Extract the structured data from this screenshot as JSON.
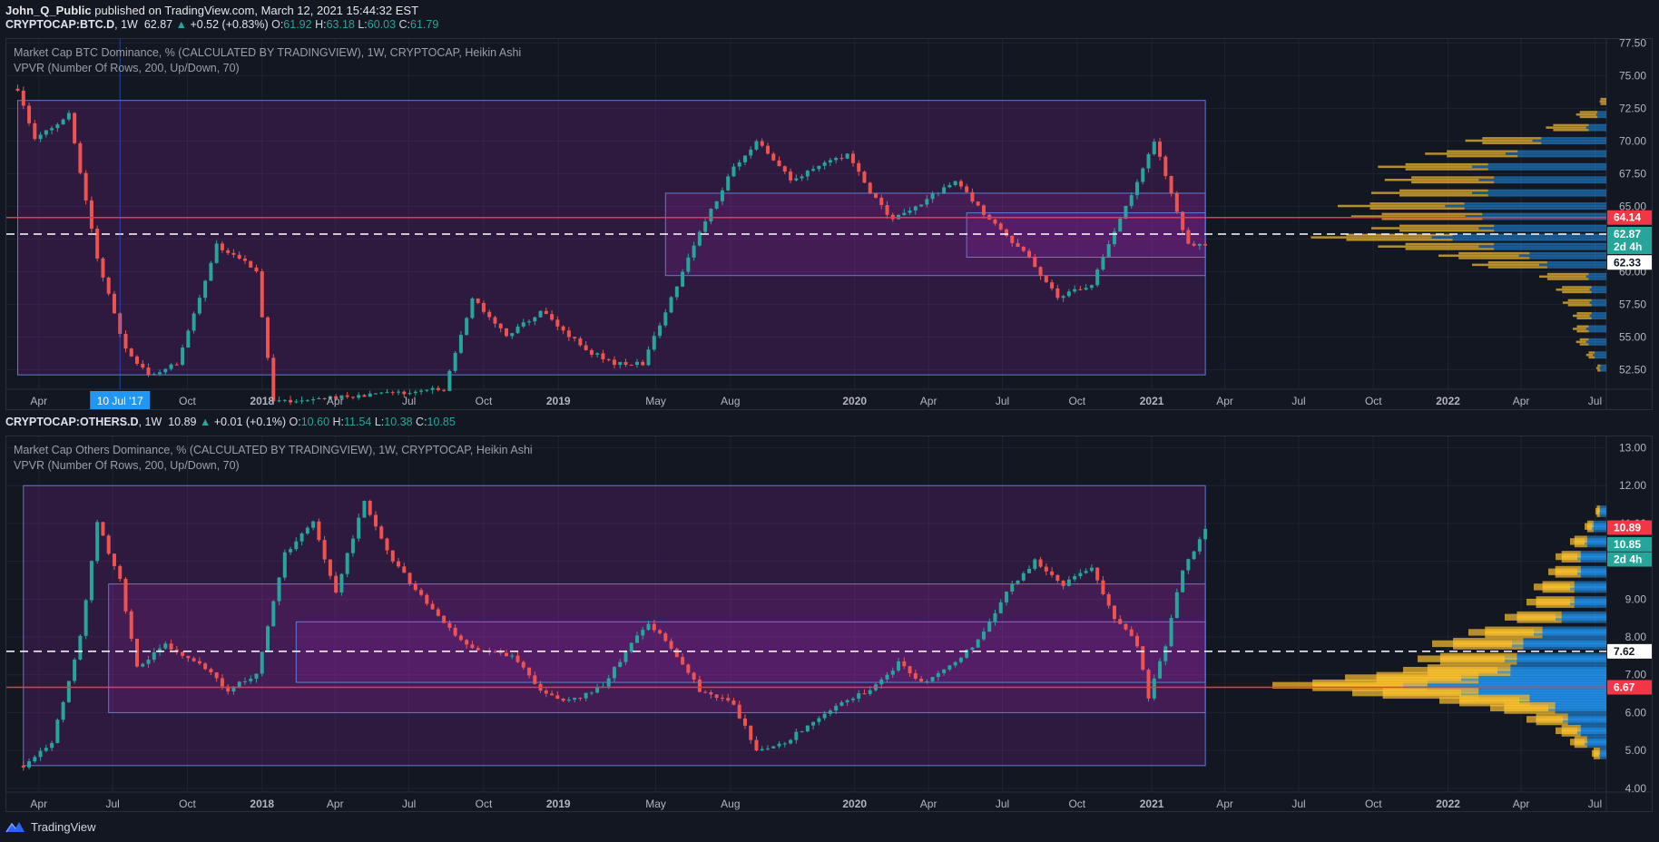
{
  "publish_line": {
    "author": "John_Q_Public",
    "text": " published on TradingView.com, March 12, 2021 15:44:32 EST"
  },
  "brand": {
    "name": "TradingView",
    "logo": "tradingview-logo-icon",
    "colors": {
      "background": "#131722",
      "up": "#26a69a",
      "down": "#ef5350",
      "box": "#5d7bd8",
      "accent": "#2962ff"
    }
  },
  "chart_data": [
    {
      "type": "candlestick",
      "symbol": "CRYPTOCAP:BTC.D",
      "interval": "1W",
      "last": "62.87",
      "change": "+0.52 (+0.83%)",
      "ohlc": {
        "o": "61.92",
        "h": "63.18",
        "l": "60.03",
        "c": "61.79"
      },
      "legend": {
        "main": "Market Cap BTC Dominance, % (CALCULATED BY TRADINGVIEW), 1W, CRYPTOCAP, Heikin Ashi",
        "indicator": "VPVR (Number Of Rows, 200, Up/Down, 70)"
      },
      "ylim": [
        51.0,
        77.8
      ],
      "y_ticks": [
        "52.50",
        "55.00",
        "57.50",
        "60.00",
        "62.50",
        "65.00",
        "67.50",
        "70.00",
        "72.50",
        "75.00",
        "77.50"
      ],
      "x_ticks": [
        {
          "label": "Apr",
          "date": "2017-04-01",
          "bold": false
        },
        {
          "label": "Oct",
          "date": "2017-10-01",
          "bold": false
        },
        {
          "label": "2018",
          "date": "2018-01-01",
          "bold": true
        },
        {
          "label": "Apr",
          "date": "2018-04-01",
          "bold": false
        },
        {
          "label": "Jul",
          "date": "2018-07-01",
          "bold": false
        },
        {
          "label": "Oct",
          "date": "2018-10-01",
          "bold": false
        },
        {
          "label": "2019",
          "date": "2019-01-01",
          "bold": true
        },
        {
          "label": "May",
          "date": "2019-05-01",
          "bold": false
        },
        {
          "label": "Aug",
          "date": "2019-08-01",
          "bold": false
        },
        {
          "label": "2020",
          "date": "2020-01-01",
          "bold": true
        },
        {
          "label": "Apr",
          "date": "2020-04-01",
          "bold": false
        },
        {
          "label": "Jul",
          "date": "2020-07-01",
          "bold": false
        },
        {
          "label": "Oct",
          "date": "2020-10-01",
          "bold": false
        },
        {
          "label": "2021",
          "date": "2021-01-01",
          "bold": true
        },
        {
          "label": "Apr",
          "date": "2021-04-01",
          "bold": false
        },
        {
          "label": "Jul",
          "date": "2021-07-01",
          "bold": false
        },
        {
          "label": "Oct",
          "date": "2021-10-01",
          "bold": false
        },
        {
          "label": "2022",
          "date": "2022-01-01",
          "bold": true
        },
        {
          "label": "Apr",
          "date": "2022-04-01",
          "bold": false
        },
        {
          "label": "Jul",
          "date": "2022-07-01",
          "bold": false
        }
      ],
      "crosshair_date_label": "10 Jul '17",
      "crosshair_date": "2017-07-10",
      "red_line": "64.14",
      "dashed_line": "62.87",
      "price_labels": [
        {
          "text": "64.14",
          "value": 64.14,
          "bg": "#f23645",
          "fg": "#ffffff"
        },
        {
          "text": "62.87",
          "value": 62.87,
          "bg": "#26a69a",
          "fg": "#ffffff"
        },
        {
          "text": "2d 4h",
          "value": 61.9,
          "bg": "#26a69a",
          "fg": "#ffffff"
        },
        {
          "text": "62.33",
          "value": 60.7,
          "bg": "#ffffff",
          "fg": "#131722"
        }
      ],
      "boxes": [
        {
          "start": "2017-03-06",
          "end": "2021-03-08",
          "low": 52.1,
          "high": 73.1
        },
        {
          "start": "2019-05-13",
          "end": "2021-03-08",
          "low": 59.7,
          "high": 66.0
        },
        {
          "start": "2020-05-18",
          "end": "2021-03-08",
          "low": 61.1,
          "high": 64.5
        }
      ],
      "anchors": [
        {
          "date": "2017-03-06",
          "value": 74
        },
        {
          "date": "2017-03-27",
          "value": 70
        },
        {
          "date": "2017-05-08",
          "value": 72
        },
        {
          "date": "2017-06-12",
          "value": 61
        },
        {
          "date": "2017-07-17",
          "value": 54
        },
        {
          "date": "2017-08-14",
          "value": 52
        },
        {
          "date": "2017-09-18",
          "value": 53
        },
        {
          "date": "2017-11-06",
          "value": 62
        },
        {
          "date": "2017-12-04",
          "value": 61
        },
        {
          "date": "2017-12-25",
          "value": 60
        },
        {
          "date": "2018-01-15",
          "value": 50
        },
        {
          "date": "2018-08-13",
          "value": 51
        },
        {
          "date": "2018-09-17",
          "value": 58
        },
        {
          "date": "2018-10-29",
          "value": 55
        },
        {
          "date": "2018-12-10",
          "value": 57
        },
        {
          "date": "2019-02-04",
          "value": 54
        },
        {
          "date": "2019-03-11",
          "value": 53
        },
        {
          "date": "2019-04-15",
          "value": 53
        },
        {
          "date": "2019-05-20",
          "value": 58
        },
        {
          "date": "2019-06-24",
          "value": 63
        },
        {
          "date": "2019-08-05",
          "value": 68
        },
        {
          "date": "2019-09-02",
          "value": 70
        },
        {
          "date": "2019-10-14",
          "value": 67
        },
        {
          "date": "2019-12-23",
          "value": 69
        },
        {
          "date": "2020-01-20",
          "value": 66
        },
        {
          "date": "2020-02-17",
          "value": 64
        },
        {
          "date": "2020-03-16",
          "value": 65
        },
        {
          "date": "2020-05-04",
          "value": 67
        },
        {
          "date": "2020-06-15",
          "value": 64
        },
        {
          "date": "2020-08-03",
          "value": 61
        },
        {
          "date": "2020-09-07",
          "value": 58
        },
        {
          "date": "2020-10-19",
          "value": 59
        },
        {
          "date": "2020-11-16",
          "value": 63
        },
        {
          "date": "2020-12-21",
          "value": 68
        },
        {
          "date": "2021-01-04",
          "value": 70
        },
        {
          "date": "2021-01-25",
          "value": 66
        },
        {
          "date": "2021-02-15",
          "value": 62
        },
        {
          "date": "2021-03-08",
          "value": 62
        }
      ],
      "vpvr_rows": [
        {
          "price": 62.6,
          "up": 0.36,
          "down": 0.52
        },
        {
          "price": 61.9,
          "up": 0.3,
          "down": 0.38
        },
        {
          "price": 61.2,
          "up": 0.24,
          "down": 0.26
        },
        {
          "price": 60.5,
          "up": 0.2,
          "down": 0.2
        },
        {
          "price": 64.2,
          "up": 0.34,
          "down": 0.42
        },
        {
          "price": 63.3,
          "up": 0.32,
          "down": 0.38
        },
        {
          "price": 65.0,
          "up": 0.32,
          "down": 0.48
        },
        {
          "price": 66.0,
          "up": 0.3,
          "down": 0.4
        },
        {
          "price": 67.0,
          "up": 0.28,
          "down": 0.38
        },
        {
          "price": 68.0,
          "up": 0.28,
          "down": 0.4
        },
        {
          "price": 69.0,
          "up": 0.24,
          "down": 0.3
        },
        {
          "price": 70.0,
          "up": 0.2,
          "down": 0.22
        },
        {
          "price": 71.0,
          "up": 0.12,
          "down": 0.06
        },
        {
          "price": 72.0,
          "up": 0.06,
          "down": 0.03
        },
        {
          "price": 73.0,
          "up": 0.02,
          "down": 0.0
        },
        {
          "price": 59.6,
          "up": 0.14,
          "down": 0.06
        },
        {
          "price": 58.6,
          "up": 0.1,
          "down": 0.05
        },
        {
          "price": 57.6,
          "up": 0.08,
          "down": 0.05
        },
        {
          "price": 56.6,
          "up": 0.05,
          "down": 0.05
        },
        {
          "price": 55.6,
          "up": 0.04,
          "down": 0.06
        },
        {
          "price": 54.6,
          "up": 0.03,
          "down": 0.06
        },
        {
          "price": 53.6,
          "up": 0.02,
          "down": 0.04
        },
        {
          "price": 52.6,
          "up": 0.01,
          "down": 0.02
        }
      ]
    },
    {
      "type": "candlestick",
      "symbol": "CRYPTOCAP:OTHERS.D",
      "interval": "1W",
      "last": "10.89",
      "change": "+0.01 (+0.1%)",
      "ohlc": {
        "o": "10.60",
        "h": "11.54",
        "l": "10.38",
        "c": "10.85"
      },
      "legend": {
        "main": "Market Cap Others Dominance, % (CALCULATED BY TRADINGVIEW), 1W, CRYPTOCAP, Heikin Ashi",
        "indicator": "VPVR (Number Of Rows, 200, Up/Down, 70)"
      },
      "ylim": [
        3.9,
        13.3
      ],
      "y_ticks": [
        "4.00",
        "5.00",
        "6.00",
        "7.00",
        "8.00",
        "9.00",
        "10.00",
        "11.00",
        "12.00",
        "13.00"
      ],
      "x_ticks": [
        {
          "label": "Apr",
          "date": "2017-04-01",
          "bold": false
        },
        {
          "label": "Jul",
          "date": "2017-07-01",
          "bold": false
        },
        {
          "label": "Oct",
          "date": "2017-10-01",
          "bold": false
        },
        {
          "label": "2018",
          "date": "2018-01-01",
          "bold": true
        },
        {
          "label": "Apr",
          "date": "2018-04-01",
          "bold": false
        },
        {
          "label": "Jul",
          "date": "2018-07-01",
          "bold": false
        },
        {
          "label": "Oct",
          "date": "2018-10-01",
          "bold": false
        },
        {
          "label": "2019",
          "date": "2019-01-01",
          "bold": true
        },
        {
          "label": "May",
          "date": "2019-05-01",
          "bold": false
        },
        {
          "label": "Aug",
          "date": "2019-08-01",
          "bold": false
        },
        {
          "label": "2020",
          "date": "2020-01-01",
          "bold": true
        },
        {
          "label": "Apr",
          "date": "2020-04-01",
          "bold": false
        },
        {
          "label": "Jul",
          "date": "2020-07-01",
          "bold": false
        },
        {
          "label": "Oct",
          "date": "2020-10-01",
          "bold": false
        },
        {
          "label": "2021",
          "date": "2021-01-01",
          "bold": true
        },
        {
          "label": "Apr",
          "date": "2021-04-01",
          "bold": false
        },
        {
          "label": "Jul",
          "date": "2021-07-01",
          "bold": false
        },
        {
          "label": "Oct",
          "date": "2021-10-01",
          "bold": false
        },
        {
          "label": "2022",
          "date": "2022-01-01",
          "bold": true
        },
        {
          "label": "Apr",
          "date": "2022-04-01",
          "bold": false
        },
        {
          "label": "Jul",
          "date": "2022-07-01",
          "bold": false
        }
      ],
      "red_line": "6.67",
      "dashed_line": "7.62",
      "price_labels": [
        {
          "text": "10.89",
          "value": 10.89,
          "bg": "#f23645",
          "fg": "#ffffff"
        },
        {
          "text": "10.85",
          "value": 10.45,
          "bg": "#26a69a",
          "fg": "#ffffff"
        },
        {
          "text": "2d 4h",
          "value": 10.05,
          "bg": "#26a69a",
          "fg": "#ffffff"
        },
        {
          "text": "7.62",
          "value": 7.62,
          "bg": "#ffffff",
          "fg": "#131722"
        },
        {
          "text": "6.67",
          "value": 6.67,
          "bg": "#f23645",
          "fg": "#ffffff"
        }
      ],
      "boxes": [
        {
          "start": "2017-03-13",
          "end": "2021-03-08",
          "low": 4.6,
          "high": 12.0
        },
        {
          "start": "2017-06-26",
          "end": "2021-03-08",
          "low": 6.0,
          "high": 9.4
        },
        {
          "start": "2018-02-12",
          "end": "2021-03-08",
          "low": 6.8,
          "high": 8.4
        }
      ],
      "anchors": [
        {
          "date": "2017-03-13",
          "value": 4.6
        },
        {
          "date": "2017-04-17",
          "value": 5.2
        },
        {
          "date": "2017-05-22",
          "value": 8.0
        },
        {
          "date": "2017-06-12",
          "value": 11.0
        },
        {
          "date": "2017-07-10",
          "value": 9.5
        },
        {
          "date": "2017-07-31",
          "value": 7.2
        },
        {
          "date": "2017-09-04",
          "value": 7.8
        },
        {
          "date": "2017-10-16",
          "value": 7.3
        },
        {
          "date": "2017-11-20",
          "value": 6.6
        },
        {
          "date": "2017-12-25",
          "value": 7.0
        },
        {
          "date": "2018-01-29",
          "value": 10.2
        },
        {
          "date": "2018-03-05",
          "value": 11.0
        },
        {
          "date": "2018-04-02",
          "value": 9.2
        },
        {
          "date": "2018-05-07",
          "value": 11.6
        },
        {
          "date": "2018-06-11",
          "value": 10.0
        },
        {
          "date": "2018-07-16",
          "value": 9.1
        },
        {
          "date": "2018-08-20",
          "value": 8.2
        },
        {
          "date": "2018-09-24",
          "value": 7.6
        },
        {
          "date": "2018-11-05",
          "value": 7.5
        },
        {
          "date": "2018-12-10",
          "value": 6.6
        },
        {
          "date": "2019-01-14",
          "value": 6.3
        },
        {
          "date": "2019-02-25",
          "value": 6.7
        },
        {
          "date": "2019-03-25",
          "value": 7.6
        },
        {
          "date": "2019-04-22",
          "value": 8.4
        },
        {
          "date": "2019-05-27",
          "value": 7.5
        },
        {
          "date": "2019-06-24",
          "value": 6.6
        },
        {
          "date": "2019-08-05",
          "value": 6.2
        },
        {
          "date": "2019-09-02",
          "value": 5.0
        },
        {
          "date": "2019-10-07",
          "value": 5.2
        },
        {
          "date": "2019-11-11",
          "value": 5.8
        },
        {
          "date": "2019-12-16",
          "value": 6.3
        },
        {
          "date": "2020-01-20",
          "value": 6.6
        },
        {
          "date": "2020-02-24",
          "value": 7.3
        },
        {
          "date": "2020-03-23",
          "value": 6.8
        },
        {
          "date": "2020-04-27",
          "value": 7.2
        },
        {
          "date": "2020-06-01",
          "value": 7.9
        },
        {
          "date": "2020-07-06",
          "value": 9.2
        },
        {
          "date": "2020-08-10",
          "value": 10.0
        },
        {
          "date": "2020-09-14",
          "value": 9.4
        },
        {
          "date": "2020-10-19",
          "value": 9.8
        },
        {
          "date": "2020-11-16",
          "value": 8.5
        },
        {
          "date": "2020-12-14",
          "value": 7.8
        },
        {
          "date": "2020-12-28",
          "value": 6.4
        },
        {
          "date": "2021-01-18",
          "value": 7.8
        },
        {
          "date": "2021-02-08",
          "value": 9.8
        },
        {
          "date": "2021-03-08",
          "value": 10.8
        }
      ],
      "vpvr_rows": [
        {
          "price": 6.7,
          "up": 0.36,
          "down": 0.56
        },
        {
          "price": 6.5,
          "up": 0.3,
          "down": 0.4
        },
        {
          "price": 6.9,
          "up": 0.32,
          "down": 0.4
        },
        {
          "price": 7.1,
          "up": 0.26,
          "down": 0.3
        },
        {
          "price": 6.3,
          "up": 0.22,
          "down": 0.24
        },
        {
          "price": 6.1,
          "up": 0.16,
          "down": 0.16
        },
        {
          "price": 7.4,
          "up": 0.24,
          "down": 0.28
        },
        {
          "price": 7.8,
          "up": 0.22,
          "down": 0.26
        },
        {
          "price": 8.1,
          "up": 0.18,
          "down": 0.2
        },
        {
          "price": 8.5,
          "up": 0.14,
          "down": 0.14
        },
        {
          "price": 8.9,
          "up": 0.12,
          "down": 0.1
        },
        {
          "price": 9.3,
          "up": 0.1,
          "down": 0.1
        },
        {
          "price": 9.7,
          "up": 0.08,
          "down": 0.08
        },
        {
          "price": 10.1,
          "up": 0.06,
          "down": 0.08
        },
        {
          "price": 10.5,
          "up": 0.04,
          "down": 0.06
        },
        {
          "price": 10.9,
          "up": 0.02,
          "down": 0.04
        },
        {
          "price": 11.3,
          "up": 0.01,
          "down": 0.02
        },
        {
          "price": 5.8,
          "up": 0.1,
          "down": 0.12
        },
        {
          "price": 5.5,
          "up": 0.06,
          "down": 0.08
        },
        {
          "price": 5.2,
          "up": 0.04,
          "down": 0.06
        },
        {
          "price": 4.9,
          "up": 0.02,
          "down": 0.02
        }
      ]
    }
  ]
}
